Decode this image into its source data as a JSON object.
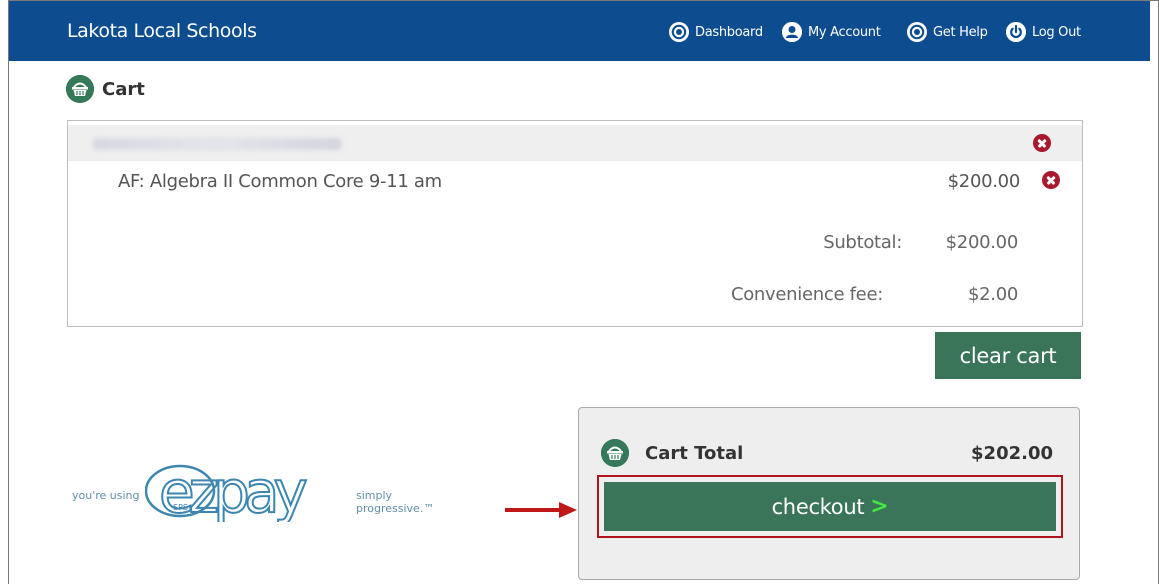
{
  "header": {
    "brand": "Lakota Local Schools",
    "nav": [
      {
        "label": "Dashboard",
        "icon": "lifebuoy-icon"
      },
      {
        "label": "My Account",
        "icon": "user-icon"
      },
      {
        "label": "Get Help",
        "icon": "lifebuoy-icon"
      },
      {
        "label": "Log Out",
        "icon": "power-icon"
      }
    ]
  },
  "page": {
    "title": "Cart",
    "icon": "basket-icon"
  },
  "cart": {
    "items": [
      {
        "name": "AF: Algebra II Common Core 9-11 am",
        "price": "$200.00"
      }
    ],
    "subtotal_label": "Subtotal:",
    "subtotal": "$200.00",
    "fee_label": "Convenience fee:",
    "fee": "$2.00",
    "clear_label": "clear cart"
  },
  "total": {
    "label": "Cart Total",
    "amount": "$202.00",
    "checkout_label": "checkout",
    "checkout_chevron": ">"
  },
  "branding": {
    "prefix": "you're using",
    "logo": "ezpay",
    "logo_sub": "SPS",
    "tagline": "simply progressive.™"
  },
  "colors": {
    "header": "#0d4c8f",
    "button": "#3a7559",
    "remove": "#a8192e",
    "highlight": "#b0141e",
    "chevron": "#42e842"
  }
}
